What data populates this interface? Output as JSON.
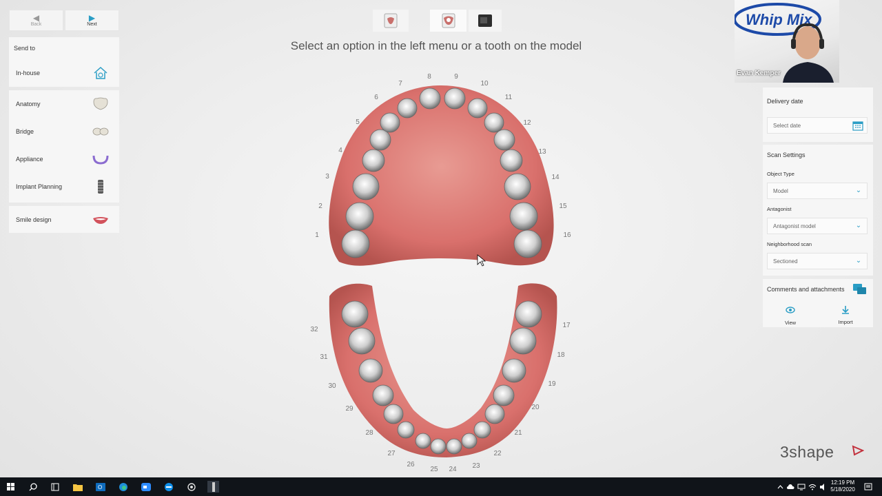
{
  "nav": {
    "back_label": "Back",
    "next_label": "Next"
  },
  "left_menu": {
    "send_to_label": "Send to",
    "in_house_label": "In-house",
    "items": [
      {
        "label": "Anatomy",
        "icon": "crown-icon"
      },
      {
        "label": "Bridge",
        "icon": "bridge-icon"
      },
      {
        "label": "Appliance",
        "icon": "appliance-icon"
      },
      {
        "label": "Implant Planning",
        "icon": "implant-icon"
      }
    ],
    "smile_design_label": "Smile design"
  },
  "headline": "Select an option in the left menu or a tooth on the model",
  "tooth_numbers": {
    "upper": [
      "1",
      "2",
      "3",
      "4",
      "5",
      "6",
      "7",
      "8",
      "9",
      "10",
      "11",
      "12",
      "13",
      "14",
      "15",
      "16"
    ],
    "lower": [
      "17",
      "18",
      "19",
      "20",
      "21",
      "22",
      "23",
      "24",
      "25",
      "26",
      "27",
      "28",
      "29",
      "30",
      "31",
      "32"
    ]
  },
  "right_panel": {
    "delivery_date_label": "Delivery date",
    "delivery_date_placeholder": "Select date",
    "scan_settings_label": "Scan Settings",
    "object_type_label": "Object Type",
    "object_type_value": "Model",
    "antagonist_label": "Antagonist",
    "antagonist_value": "Antagonist model",
    "neighborhood_label": "Neighborhood scan",
    "neighborhood_value": "Sectioned",
    "comments_label": "Comments and attachments",
    "view_label": "View",
    "import_label": "Import"
  },
  "webcam": {
    "logo_text": "Whip Mix",
    "name": "Evan Kemper"
  },
  "brand": "3shape",
  "taskbar": {
    "time": "12:19 PM",
    "date": "5/18/2020"
  },
  "colors": {
    "accent": "#2a9dc5",
    "gum": "#d9706c",
    "brand_red": "#c2303c"
  }
}
